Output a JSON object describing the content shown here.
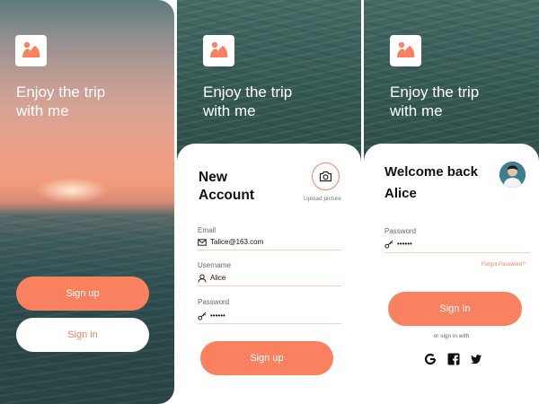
{
  "colors": {
    "accent": "#fa8160",
    "white": "#ffffff",
    "text_dark": "#111111",
    "text_muted": "#666666",
    "field_line": "#f4cfc2"
  },
  "tagline": "Enjoy the trip\nwith me",
  "logo_icon": "image-icon",
  "welcome_screen": {
    "signup_label": "Sign up",
    "signin_label": "Sign in"
  },
  "signup_screen": {
    "title": "New\nAccount",
    "upload_icon": "camera-icon",
    "upload_label": "Upload picture",
    "fields": {
      "email": {
        "label": "Email",
        "value": "Talice@163.com",
        "icon": "mail-icon"
      },
      "username": {
        "label": "Username",
        "value": "Alice",
        "icon": "user-icon"
      },
      "password": {
        "label": "Password",
        "value": "••••••",
        "icon": "key-icon"
      }
    },
    "submit_label": "Sign up"
  },
  "signin_screen": {
    "title": "Welcome back\nAlice",
    "avatar_icon": "avatar",
    "fields": {
      "password": {
        "label": "Password",
        "value": "••••••",
        "icon": "key-icon"
      }
    },
    "forgot_label": "Forgot Password?",
    "submit_label": "Sign In",
    "alt_label": "or sign in with",
    "social": [
      "google-icon",
      "facebook-icon",
      "twitter-icon"
    ]
  }
}
